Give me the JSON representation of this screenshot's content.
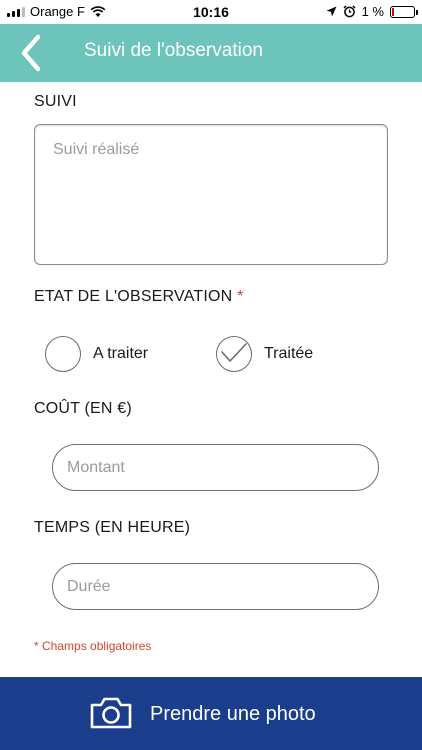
{
  "status_bar": {
    "carrier": "Orange F",
    "time": "10:16",
    "battery": "1 %"
  },
  "header": {
    "title": "Suivi de l'observation"
  },
  "form": {
    "suivi": {
      "label": "SUIVI",
      "placeholder": "Suivi réalisé",
      "value": ""
    },
    "etat": {
      "label": "ETAT DE L'OBSERVATION",
      "required_mark": "*",
      "options": [
        {
          "label": "A traiter",
          "selected": false
        },
        {
          "label": "Traitée",
          "selected": true
        }
      ]
    },
    "cout": {
      "label": "COÛT (EN €)",
      "placeholder": "Montant",
      "value": ""
    },
    "temps": {
      "label": "TEMPS (EN HEURE)",
      "placeholder": "Durée",
      "value": ""
    },
    "required_note": "* Champs obligatoires"
  },
  "photo_button": {
    "label": "Prendre une photo",
    "icon": "camera-icon"
  },
  "colors": {
    "header": "#6cc4bb",
    "photo_bar": "#1b3e8c",
    "required": "#d0452f"
  }
}
